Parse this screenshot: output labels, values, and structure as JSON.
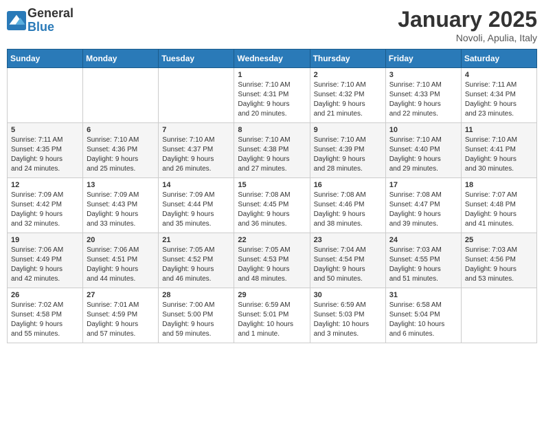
{
  "logo": {
    "general": "General",
    "blue": "Blue"
  },
  "title": "January 2025",
  "subtitle": "Novoli, Apulia, Italy",
  "weekdays": [
    "Sunday",
    "Monday",
    "Tuesday",
    "Wednesday",
    "Thursday",
    "Friday",
    "Saturday"
  ],
  "weeks": [
    [
      {
        "day": "",
        "info": ""
      },
      {
        "day": "",
        "info": ""
      },
      {
        "day": "",
        "info": ""
      },
      {
        "day": "1",
        "info": "Sunrise: 7:10 AM\nSunset: 4:31 PM\nDaylight: 9 hours\nand 20 minutes."
      },
      {
        "day": "2",
        "info": "Sunrise: 7:10 AM\nSunset: 4:32 PM\nDaylight: 9 hours\nand 21 minutes."
      },
      {
        "day": "3",
        "info": "Sunrise: 7:10 AM\nSunset: 4:33 PM\nDaylight: 9 hours\nand 22 minutes."
      },
      {
        "day": "4",
        "info": "Sunrise: 7:11 AM\nSunset: 4:34 PM\nDaylight: 9 hours\nand 23 minutes."
      }
    ],
    [
      {
        "day": "5",
        "info": "Sunrise: 7:11 AM\nSunset: 4:35 PM\nDaylight: 9 hours\nand 24 minutes."
      },
      {
        "day": "6",
        "info": "Sunrise: 7:10 AM\nSunset: 4:36 PM\nDaylight: 9 hours\nand 25 minutes."
      },
      {
        "day": "7",
        "info": "Sunrise: 7:10 AM\nSunset: 4:37 PM\nDaylight: 9 hours\nand 26 minutes."
      },
      {
        "day": "8",
        "info": "Sunrise: 7:10 AM\nSunset: 4:38 PM\nDaylight: 9 hours\nand 27 minutes."
      },
      {
        "day": "9",
        "info": "Sunrise: 7:10 AM\nSunset: 4:39 PM\nDaylight: 9 hours\nand 28 minutes."
      },
      {
        "day": "10",
        "info": "Sunrise: 7:10 AM\nSunset: 4:40 PM\nDaylight: 9 hours\nand 29 minutes."
      },
      {
        "day": "11",
        "info": "Sunrise: 7:10 AM\nSunset: 4:41 PM\nDaylight: 9 hours\nand 30 minutes."
      }
    ],
    [
      {
        "day": "12",
        "info": "Sunrise: 7:09 AM\nSunset: 4:42 PM\nDaylight: 9 hours\nand 32 minutes."
      },
      {
        "day": "13",
        "info": "Sunrise: 7:09 AM\nSunset: 4:43 PM\nDaylight: 9 hours\nand 33 minutes."
      },
      {
        "day": "14",
        "info": "Sunrise: 7:09 AM\nSunset: 4:44 PM\nDaylight: 9 hours\nand 35 minutes."
      },
      {
        "day": "15",
        "info": "Sunrise: 7:08 AM\nSunset: 4:45 PM\nDaylight: 9 hours\nand 36 minutes."
      },
      {
        "day": "16",
        "info": "Sunrise: 7:08 AM\nSunset: 4:46 PM\nDaylight: 9 hours\nand 38 minutes."
      },
      {
        "day": "17",
        "info": "Sunrise: 7:08 AM\nSunset: 4:47 PM\nDaylight: 9 hours\nand 39 minutes."
      },
      {
        "day": "18",
        "info": "Sunrise: 7:07 AM\nSunset: 4:48 PM\nDaylight: 9 hours\nand 41 minutes."
      }
    ],
    [
      {
        "day": "19",
        "info": "Sunrise: 7:06 AM\nSunset: 4:49 PM\nDaylight: 9 hours\nand 42 minutes."
      },
      {
        "day": "20",
        "info": "Sunrise: 7:06 AM\nSunset: 4:51 PM\nDaylight: 9 hours\nand 44 minutes."
      },
      {
        "day": "21",
        "info": "Sunrise: 7:05 AM\nSunset: 4:52 PM\nDaylight: 9 hours\nand 46 minutes."
      },
      {
        "day": "22",
        "info": "Sunrise: 7:05 AM\nSunset: 4:53 PM\nDaylight: 9 hours\nand 48 minutes."
      },
      {
        "day": "23",
        "info": "Sunrise: 7:04 AM\nSunset: 4:54 PM\nDaylight: 9 hours\nand 50 minutes."
      },
      {
        "day": "24",
        "info": "Sunrise: 7:03 AM\nSunset: 4:55 PM\nDaylight: 9 hours\nand 51 minutes."
      },
      {
        "day": "25",
        "info": "Sunrise: 7:03 AM\nSunset: 4:56 PM\nDaylight: 9 hours\nand 53 minutes."
      }
    ],
    [
      {
        "day": "26",
        "info": "Sunrise: 7:02 AM\nSunset: 4:58 PM\nDaylight: 9 hours\nand 55 minutes."
      },
      {
        "day": "27",
        "info": "Sunrise: 7:01 AM\nSunset: 4:59 PM\nDaylight: 9 hours\nand 57 minutes."
      },
      {
        "day": "28",
        "info": "Sunrise: 7:00 AM\nSunset: 5:00 PM\nDaylight: 9 hours\nand 59 minutes."
      },
      {
        "day": "29",
        "info": "Sunrise: 6:59 AM\nSunset: 5:01 PM\nDaylight: 10 hours\nand 1 minute."
      },
      {
        "day": "30",
        "info": "Sunrise: 6:59 AM\nSunset: 5:03 PM\nDaylight: 10 hours\nand 3 minutes."
      },
      {
        "day": "31",
        "info": "Sunrise: 6:58 AM\nSunset: 5:04 PM\nDaylight: 10 hours\nand 6 minutes."
      },
      {
        "day": "",
        "info": ""
      }
    ]
  ]
}
